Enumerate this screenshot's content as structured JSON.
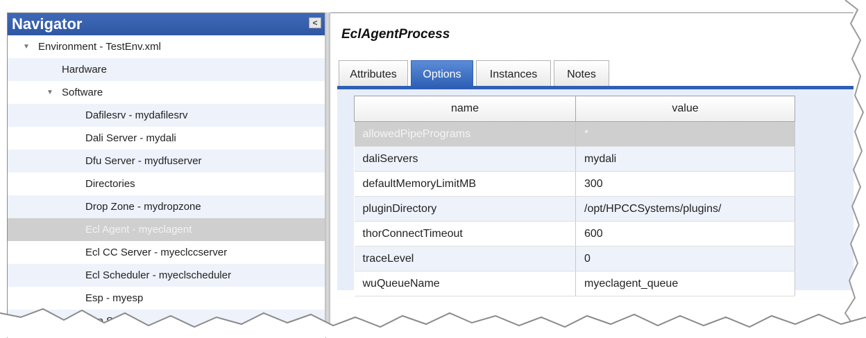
{
  "navigator": {
    "title": "Navigator",
    "collapse_glyph": "<",
    "items": [
      {
        "label": "Environment - TestEnv.xml",
        "twisty": "expanded"
      },
      {
        "label": "Hardware"
      },
      {
        "label": "Software",
        "twisty": "expanded"
      },
      {
        "label": "Dafilesrv - mydafilesrv"
      },
      {
        "label": "Dali Server - mydali"
      },
      {
        "label": "Dfu Server - mydfuserver"
      },
      {
        "label": "Directories"
      },
      {
        "label": "Drop Zone - mydropzone"
      },
      {
        "label": "Ecl Agent - myeclagent",
        "selected": true
      },
      {
        "label": "Ecl CC Server - myeclccserver"
      },
      {
        "label": "Ecl Scheduler - myeclscheduler"
      },
      {
        "label": "Esp - myesp"
      },
      {
        "label": "Esp S"
      }
    ]
  },
  "main": {
    "title": "EclAgentProcess",
    "tabs": [
      {
        "label": "Attributes"
      },
      {
        "label": "Options",
        "active": true
      },
      {
        "label": "Instances"
      },
      {
        "label": "Notes"
      }
    ],
    "grid": {
      "headers": {
        "name": "name",
        "value": "value"
      },
      "rows": [
        {
          "name": "allowedPipePrograms",
          "value": "*",
          "selected": true
        },
        {
          "name": "daliServers",
          "value": "mydali"
        },
        {
          "name": "defaultMemoryLimitMB",
          "value": "300"
        },
        {
          "name": "pluginDirectory",
          "value": "/opt/HPCCSystems/plugins/"
        },
        {
          "name": "thorConnectTimeout",
          "value": "600"
        },
        {
          "name": "traceLevel",
          "value": "0"
        },
        {
          "name": "wuQueueName",
          "value": "myeclagent_queue"
        }
      ]
    }
  },
  "colors": {
    "header_blue": "#2f57a3",
    "tab_active": "#2d5fb4",
    "selection_gray": "#cfcfcf",
    "row_alt": "#eef2fb"
  }
}
